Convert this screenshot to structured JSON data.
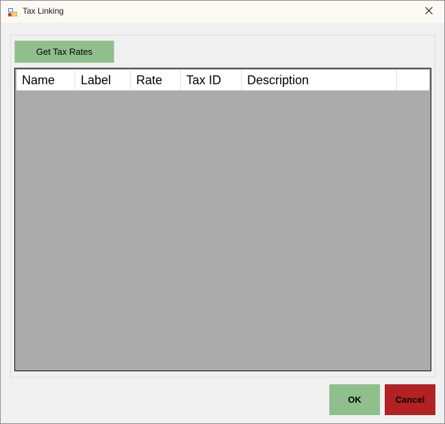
{
  "window": {
    "title": "Tax Linking"
  },
  "toolbar": {
    "get_rates_label": "Get Tax Rates"
  },
  "grid": {
    "columns": [
      "Name",
      "Label",
      "Rate",
      "Tax ID",
      "Description",
      ""
    ],
    "rows": []
  },
  "footer": {
    "ok_label": "OK",
    "cancel_label": "Cancel"
  },
  "colors": {
    "green_button": "#8fbf8a",
    "cancel_button": "#b22222",
    "grid_background": "#ababab",
    "window_background": "#f0f0f0"
  },
  "icons": {
    "app": "app-icon",
    "close": "close-icon"
  }
}
